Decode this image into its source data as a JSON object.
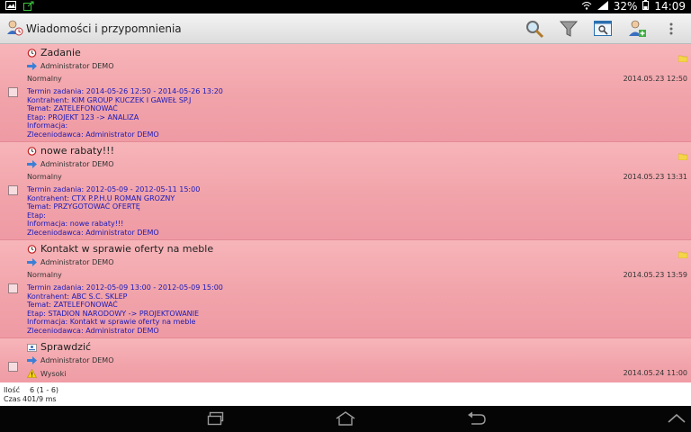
{
  "statusbar": {
    "battery": "32%",
    "time": "14:09"
  },
  "app": {
    "title": "Wiadomości i przypomnienia"
  },
  "rows": [
    {
      "title": "Zadanie",
      "user": "Administrator DEMO",
      "priority": "Normalny",
      "date": "2014.05.23 12:50",
      "details": [
        "Termin zadania: 2014-05-26 12:50 - 2014-05-26 13:20",
        "Kontrahent: KIM GROUP KUCZEK I GAWEŁ SP.J",
        "Temat: ZATELEFONOWAĆ",
        "Etap: PROJEKT 123 -> ANALIZA",
        "Informacja:",
        "Zleceniodawca: Administrator DEMO"
      ]
    },
    {
      "title": "nowe rabaty!!!",
      "user": "Administrator DEMO",
      "priority": "Normalny",
      "date": "2014.05.23 13:31",
      "details": [
        "Termin zadania: 2012-05-09 - 2012-05-11 15:00",
        "Kontrahent: CTX P.P.H.U ROMAN GROZNY",
        "Temat: PRZYGOTOWAĆ OFERTĘ",
        "Etap:",
        "Informacja: nowe rabaty!!!",
        "Zleceniodawca: Administrator DEMO"
      ]
    },
    {
      "title": "Kontakt w sprawie oferty na meble",
      "user": "Administrator DEMO",
      "priority": "Normalny",
      "date": "2014.05.23 13:59",
      "details": [
        "Termin zadania: 2012-05-09 13:00 - 2012-05-09 15:00",
        "Kontrahent: ABC S.C. SKLEP",
        "Temat: ZATELEFONOWAĆ",
        "Etap: STADION NARODOWY -> PROJEKTOWANIE",
        "Informacja: Kontakt w sprawie oferty na meble",
        "Zleceniodawca: Administrator DEMO"
      ]
    },
    {
      "title": "Sprawdzić",
      "user": "Administrator DEMO",
      "priority": "Wysoki",
      "date": "2014.05.24 11:00",
      "details": []
    }
  ],
  "footer": {
    "count_label": "Ilość",
    "count_value": "6 (1 - 6)",
    "time_label": "Czas",
    "time_value": "401/9 ms"
  },
  "colors": {
    "row_bg": "#f1a3aa",
    "detail_text": "#1a1ab8"
  }
}
